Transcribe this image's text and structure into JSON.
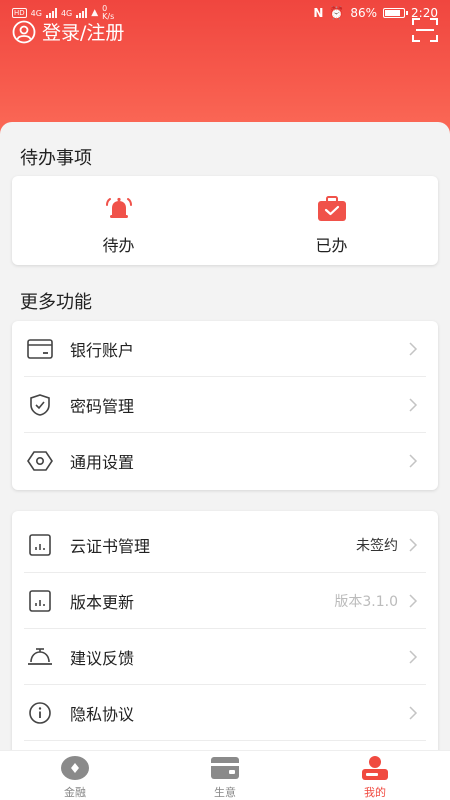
{
  "status_bar": {
    "network_left": "4G",
    "network_right": "4G",
    "speed_value": "0",
    "speed_unit": "K/s",
    "battery": "86%",
    "battery_level": 0.86,
    "time": "2:20"
  },
  "header": {
    "login_label": "登录/注册"
  },
  "todo": {
    "title": "待办事项",
    "items": [
      {
        "label": "待办",
        "icon": "bell-icon"
      },
      {
        "label": "已办",
        "icon": "briefcase-check-icon"
      }
    ]
  },
  "more": {
    "title": "更多功能",
    "items": [
      {
        "label": "银行账户",
        "icon": "bank-card-icon"
      },
      {
        "label": "密码管理",
        "icon": "shield-check-icon"
      },
      {
        "label": "通用设置",
        "icon": "hexagon-settings-icon"
      }
    ]
  },
  "misc": {
    "items": [
      {
        "label": "云证书管理",
        "value": "未签约",
        "icon": "certificate-icon"
      },
      {
        "label": "版本更新",
        "value": "版本3.1.0",
        "icon": "chart-doc-icon"
      },
      {
        "label": "建议反馈",
        "value": "",
        "icon": "service-bell-icon"
      },
      {
        "label": "隐私协议",
        "value": "",
        "icon": "info-circle-icon"
      }
    ]
  },
  "tabbar": {
    "items": [
      {
        "label": "金融",
        "icon": "finance-icon",
        "active": false
      },
      {
        "label": "生意",
        "icon": "wallet-icon",
        "active": false
      },
      {
        "label": "我的",
        "icon": "profile-icon",
        "active": true
      }
    ]
  },
  "colors": {
    "brand": "#f04a40",
    "icon_gray": "#444444",
    "tab_inactive": "#888888"
  }
}
